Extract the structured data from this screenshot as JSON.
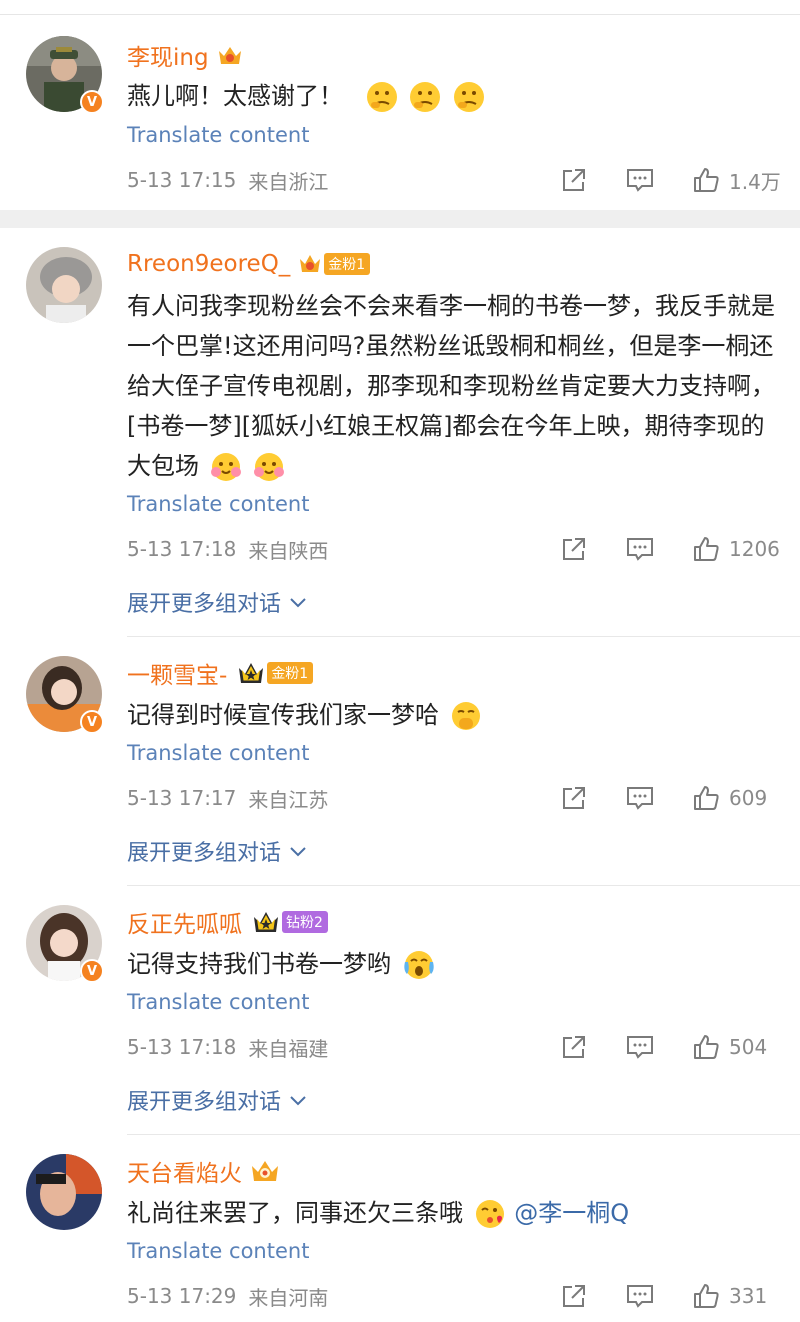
{
  "ui": {
    "translate_label": "Translate content",
    "expand_label": "展开更多组对话",
    "vip_mark": "V",
    "accent_color": "#f0721e",
    "link_color": "#5b82b8"
  },
  "comments": [
    {
      "username": "李现ing",
      "fan_badge": "",
      "text": "燕儿啊！太感谢了！",
      "emojis": [
        "thinking-face",
        "thinking-face",
        "thinking-face"
      ],
      "date": "5-13 17:15",
      "location": "来自浙江",
      "likes": "1.4万",
      "verified": true
    },
    {
      "username": "Rreon9eoreQ_",
      "fan_badge": "金粉1",
      "text": "有人问我李现粉丝会不会来看李一桐的书卷一梦，我反手就是一个巴掌!这还用问吗?虽然粉丝诋毁桐和桐丝，但是李一桐还给大侄子宣传电视剧，那李现和李现粉丝肯定要大力支持啊， [书卷一梦][狐妖小红娘王权篇]都会在今年上映，期待李现的大包场",
      "emojis": [
        "flower-face",
        "flower-face"
      ],
      "date": "5-13 17:18",
      "location": "来自陕西",
      "likes": "1206",
      "verified": false
    },
    {
      "username": "一颗雪宝-",
      "fan_badge": "金粉1",
      "text": "记得到时候宣传我们家一梦哈",
      "emojis": [
        "shushing-face"
      ],
      "date": "5-13 17:17",
      "location": "来自江苏",
      "likes": "609",
      "verified": true
    },
    {
      "username": "反正先呱呱",
      "fan_badge": "钻粉2",
      "text": "记得支持我们书卷一梦哟",
      "emojis": [
        "crying-face"
      ],
      "date": "5-13 17:18",
      "location": "来自福建",
      "likes": "504",
      "verified": true
    },
    {
      "username": "天台看焰火",
      "fan_badge": "",
      "text": "礼尚往来罢了，同事还欠三条哦",
      "emojis": [
        "kiss-face"
      ],
      "mention": "@李一桐Q",
      "date": "5-13 17:29",
      "location": "来自河南",
      "likes": "331",
      "verified": false
    }
  ]
}
